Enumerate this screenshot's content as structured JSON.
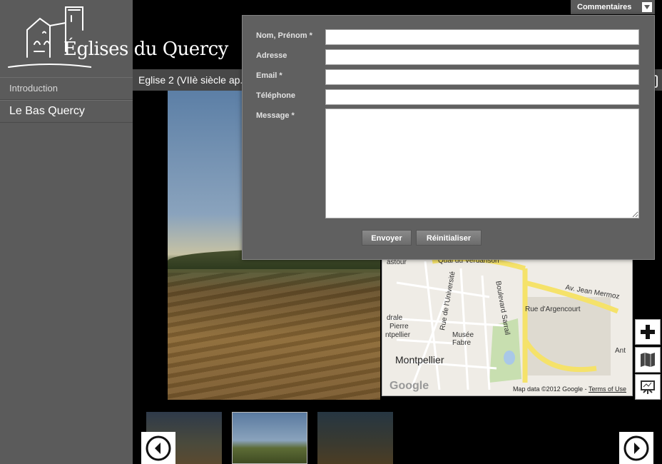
{
  "site": {
    "title": "Églises du Quercy"
  },
  "nav": {
    "items": [
      {
        "label": "Introduction"
      },
      {
        "label": "Le Bas Quercy"
      }
    ]
  },
  "header": {
    "subtitle": "Eglise 2 (VIIè siècle ap."
  },
  "comments": {
    "tab_label": "Commentaires"
  },
  "form": {
    "fields": [
      {
        "label": "Nom, Prénom *"
      },
      {
        "label": "Adresse"
      },
      {
        "label": "Email *"
      },
      {
        "label": "Téléphone"
      },
      {
        "label": "Message *"
      }
    ],
    "submit_label": "Envoyer",
    "reset_label": "Réinitialiser"
  },
  "map": {
    "city": "Montpellier",
    "labels": [
      "Quai du Verdanson",
      "Av. Jean Mermoz",
      "Rue d'Argencourt",
      "Rue de l'Université",
      "Boulevard Sarrail",
      "Musée Fabre",
      "Pierre",
      "drale",
      "ntpellier",
      "Ant",
      "astour"
    ],
    "credit": "Map data ©2012 Google",
    "terms": "Terms of Use",
    "logo": "Google"
  },
  "tools": [
    "zoom-plus-icon",
    "map-icon",
    "easel-icon"
  ]
}
